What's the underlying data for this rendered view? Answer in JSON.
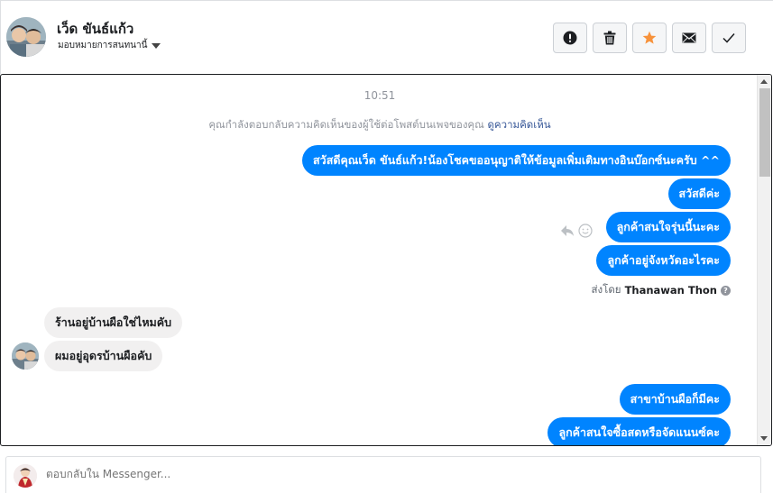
{
  "header": {
    "contact_name": "เว็ด ขันธ์แก้ว",
    "assign_label": "มอบหมายการสนทนานี้",
    "buttons": [
      {
        "name": "spam",
        "icon": "alert-icon"
      },
      {
        "name": "delete",
        "icon": "trash-icon"
      },
      {
        "name": "star",
        "icon": "star-icon"
      },
      {
        "name": "unread",
        "icon": "envelope-icon"
      },
      {
        "name": "done",
        "icon": "check-icon"
      }
    ]
  },
  "conversation": {
    "timestamp": "10:51",
    "notice_text": "คุณกำลังตอบกลับความคิดเห็นของผู้ใช้ต่อโพสต์บนเพจของคุณ",
    "notice_link": "ดูความคิดเห็น",
    "outgoing_1": [
      "สวัสดีคุณเว็ด ขันธ์แก้ว!น้องโชคขออนุญาติให้ข้อมูลเพิ่มเติมทางอินบ๊อกซ์นะครับ ^^",
      "สวัสดีค่ะ",
      "ลูกค้าสนใจรุ่นนี้นะคะ",
      "ลูกค้าอยู่จังหวัดอะไรคะ"
    ],
    "sent_by_label": "ส่งโดย",
    "sent_by_name": "Thanawan Thon",
    "incoming": [
      "ร้านอยู่บ้านผือใช่ไหมคับ",
      "ผมอยู่อุดรบ้านผือคับ"
    ],
    "outgoing_2": [
      "สาขาบ้านผือก็มีคะ",
      "ลูกค้าสนใจซื้อสดหรือจัดแนนซ์คะ"
    ]
  },
  "reply": {
    "placeholder": "ตอบกลับใน Messenger..."
  },
  "colors": {
    "outgoing_bubble": "#0084ff",
    "incoming_bubble": "#f1f0f0",
    "star": "#f7923b"
  }
}
